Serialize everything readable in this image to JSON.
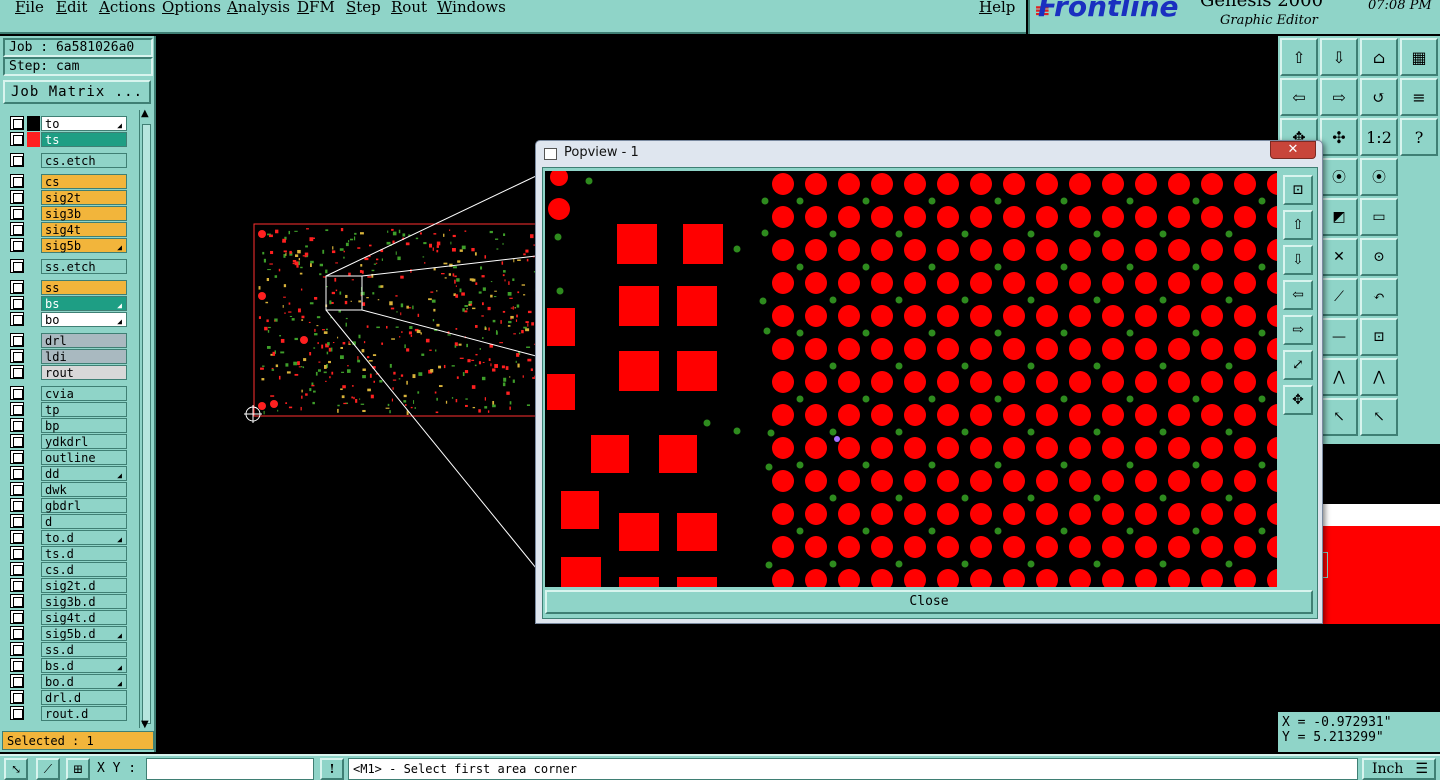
{
  "menu": {
    "items": [
      "File",
      "Edit",
      "Actions",
      "Options",
      "Analysis",
      "DFM",
      "Step",
      "Rout",
      "Windows"
    ],
    "help": "Help"
  },
  "logo": {
    "brand": "Frontline",
    "product": "Genesis 2000",
    "subtitle": "Graphic Editor",
    "time": "07:08  PM"
  },
  "job": {
    "job_label": "Job : 6a581026a0",
    "step_label": "Step: cam",
    "matrix_button": "Job Matrix ..."
  },
  "layers": [
    {
      "name": "to",
      "color": "#ffffff",
      "swatch": "#000000",
      "flag": true
    },
    {
      "name": "ts",
      "color": "#1e9e84",
      "swatch": "#ff2020",
      "flag": false
    },
    {
      "name": "cs.etch",
      "color": "#8fd4c8",
      "swatch": "",
      "flag": false
    },
    {
      "name": "cs",
      "color": "#f2b53b",
      "swatch": "",
      "flag": false
    },
    {
      "name": "sig2t",
      "color": "#f2b53b",
      "swatch": "",
      "flag": false
    },
    {
      "name": "sig3b",
      "color": "#f2b53b",
      "swatch": "",
      "flag": false
    },
    {
      "name": "sig4t",
      "color": "#f2b53b",
      "swatch": "",
      "flag": false
    },
    {
      "name": "sig5b",
      "color": "#f2b53b",
      "swatch": "",
      "flag": true
    },
    {
      "name": "ss.etch",
      "color": "#8fd4c8",
      "swatch": "",
      "flag": false
    },
    {
      "name": "ss",
      "color": "#f2b53b",
      "swatch": "",
      "flag": false
    },
    {
      "name": "bs",
      "color": "#1e9e84",
      "swatch": "",
      "flag": true
    },
    {
      "name": "bo",
      "color": "#ffffff",
      "swatch": "",
      "flag": true
    },
    {
      "name": "drl",
      "color": "#a9b9c0",
      "swatch": "",
      "flag": false
    },
    {
      "name": "ldi",
      "color": "#a9b9c0",
      "swatch": "",
      "flag": false
    },
    {
      "name": "rout",
      "color": "#d8d8d8",
      "swatch": "",
      "flag": false
    },
    {
      "name": "cvia",
      "color": "#8fd4c8",
      "swatch": "",
      "flag": false
    },
    {
      "name": "tp",
      "color": "#8fd4c8",
      "swatch": "",
      "flag": false
    },
    {
      "name": "bp",
      "color": "#8fd4c8",
      "swatch": "",
      "flag": false
    },
    {
      "name": "ydkdrl",
      "color": "#8fd4c8",
      "swatch": "",
      "flag": false
    },
    {
      "name": "outline",
      "color": "#8fd4c8",
      "swatch": "",
      "flag": false
    },
    {
      "name": "dd",
      "color": "#8fd4c8",
      "swatch": "",
      "flag": true
    },
    {
      "name": "dwk",
      "color": "#8fd4c8",
      "swatch": "",
      "flag": false
    },
    {
      "name": "gbdrl",
      "color": "#8fd4c8",
      "swatch": "",
      "flag": false
    },
    {
      "name": "d",
      "color": "#8fd4c8",
      "swatch": "",
      "flag": false
    },
    {
      "name": "to.d",
      "color": "#8fd4c8",
      "swatch": "",
      "flag": true
    },
    {
      "name": "ts.d",
      "color": "#8fd4c8",
      "swatch": "",
      "flag": false
    },
    {
      "name": "cs.d",
      "color": "#8fd4c8",
      "swatch": "",
      "flag": false
    },
    {
      "name": "sig2t.d",
      "color": "#8fd4c8",
      "swatch": "",
      "flag": false
    },
    {
      "name": "sig3b.d",
      "color": "#8fd4c8",
      "swatch": "",
      "flag": false
    },
    {
      "name": "sig4t.d",
      "color": "#8fd4c8",
      "swatch": "",
      "flag": false
    },
    {
      "name": "sig5b.d",
      "color": "#8fd4c8",
      "swatch": "",
      "flag": true
    },
    {
      "name": "ss.d",
      "color": "#8fd4c8",
      "swatch": "",
      "flag": false
    },
    {
      "name": "bs.d",
      "color": "#8fd4c8",
      "swatch": "",
      "flag": true
    },
    {
      "name": "bo.d",
      "color": "#8fd4c8",
      "swatch": "",
      "flag": true
    },
    {
      "name": "drl.d",
      "color": "#8fd4c8",
      "swatch": "",
      "flag": false
    },
    {
      "name": "rout.d",
      "color": "#8fd4c8",
      "swatch": "",
      "flag": false
    }
  ],
  "selected": "Selected : 1",
  "popview": {
    "title": "Popview - 1",
    "close_x": "✕",
    "close_button": "Close"
  },
  "coords": {
    "x": "X = -0.972931\"",
    "y": "Y = 5.213299\""
  },
  "status": {
    "xy_label": "X Y :",
    "xy_value": "",
    "prompt": "<M1> - Select first area corner",
    "units": "Inch"
  },
  "colors": {
    "panel": "#8fd4c8",
    "pad": "#ff0000",
    "via": "#2e8b1e",
    "cursor": "#a070ff"
  }
}
